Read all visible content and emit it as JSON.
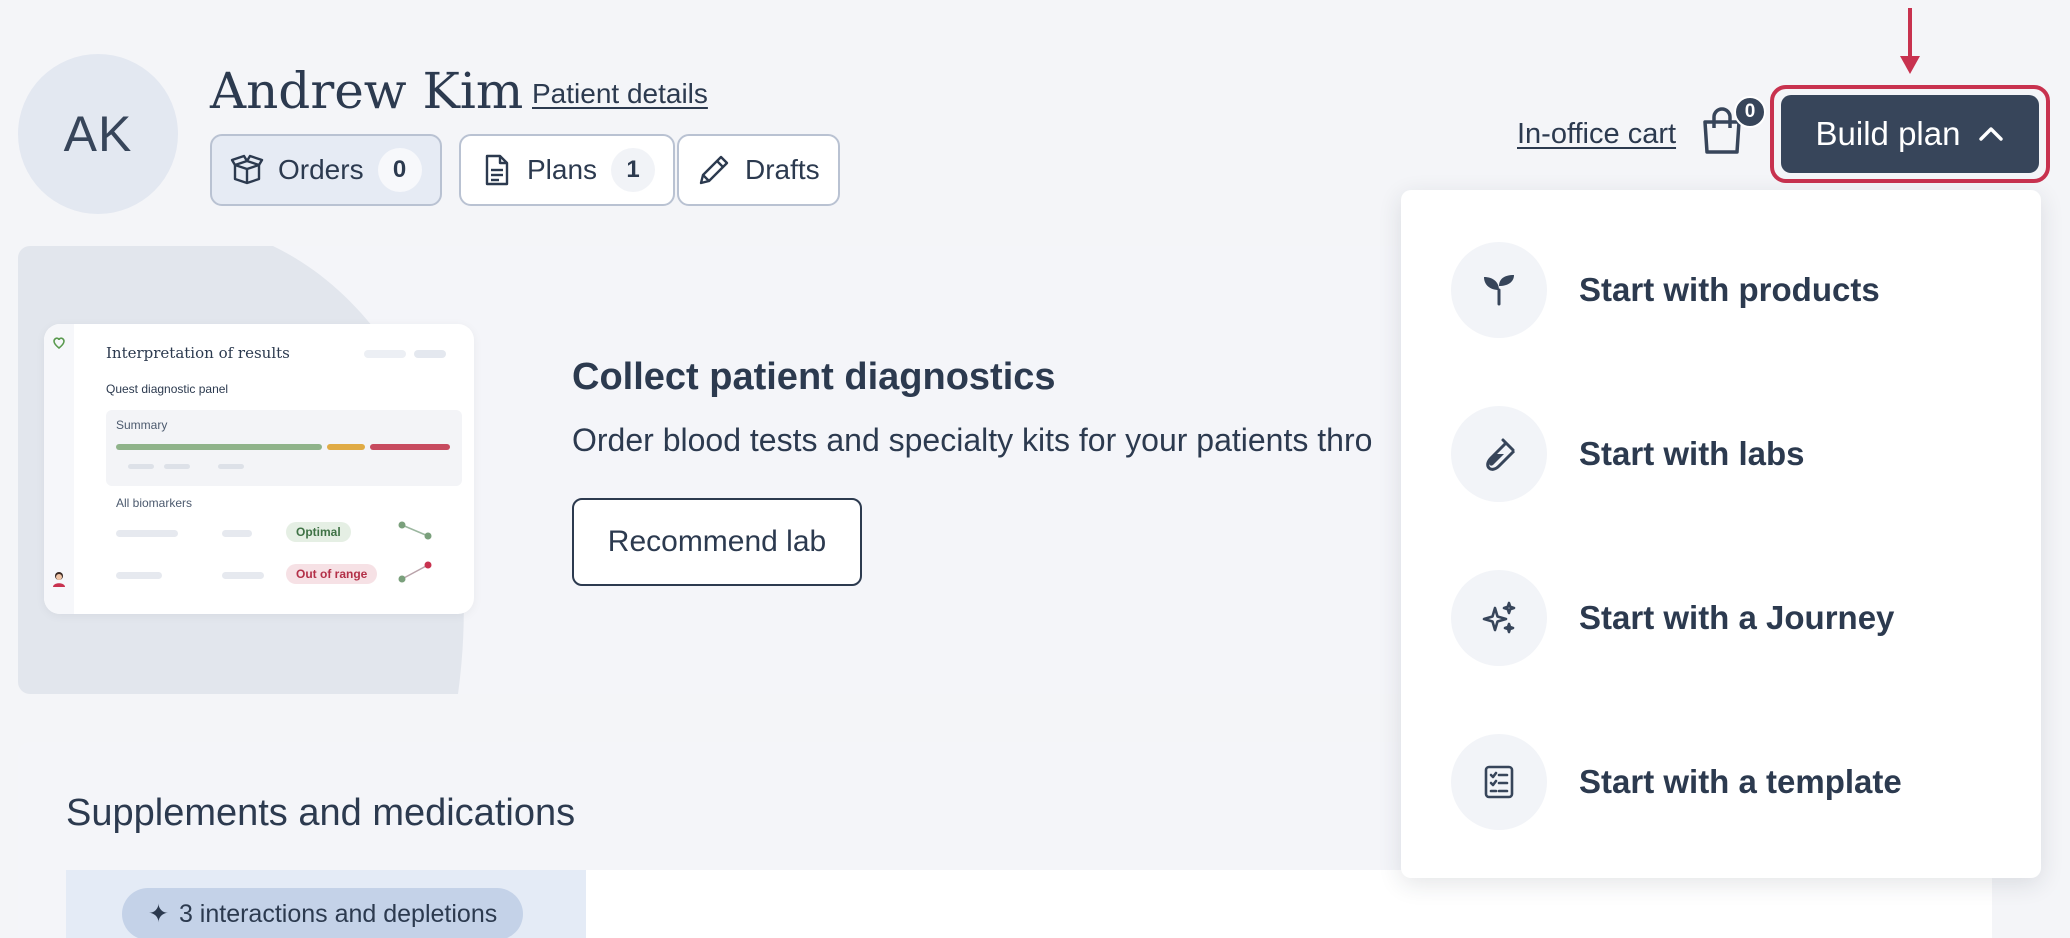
{
  "patient": {
    "initials": "AK",
    "name": "Andrew Kim",
    "details_link": "Patient details"
  },
  "tabs": [
    {
      "label": "Orders",
      "count": "0",
      "icon": "box-icon"
    },
    {
      "label": "Plans",
      "count": "1",
      "icon": "document-icon"
    },
    {
      "label": "Drafts",
      "icon": "pencil-icon"
    }
  ],
  "header": {
    "cart_label": "In-office cart",
    "cart_count": "0",
    "build_plan_label": "Build plan"
  },
  "banner": {
    "title": "Collect patient diagnostics",
    "description": "Order blood tests and specialty kits for your patients thro",
    "button": "Recommend lab",
    "preview": {
      "title": "Interpretation of results",
      "subtitle": "Quest diagnostic panel",
      "summary": "Summary",
      "all_biomarkers": "All biomarkers",
      "tag_optimal": "Optimal",
      "tag_out_of_range": "Out of range"
    }
  },
  "supplements": {
    "title": "Supplements and medications",
    "interactions": "3 interactions and depletions"
  },
  "menu": {
    "items": [
      {
        "label": "Start with products",
        "icon": "sprout-icon"
      },
      {
        "label": "Start with labs",
        "icon": "test-tube-icon"
      },
      {
        "label": "Start with a Journey",
        "icon": "sparkles-icon"
      },
      {
        "label": "Start with a template",
        "icon": "checklist-icon"
      }
    ]
  },
  "colors": {
    "primary": "#37455a",
    "highlight": "#c8324f",
    "background": "#f4f5f9"
  }
}
